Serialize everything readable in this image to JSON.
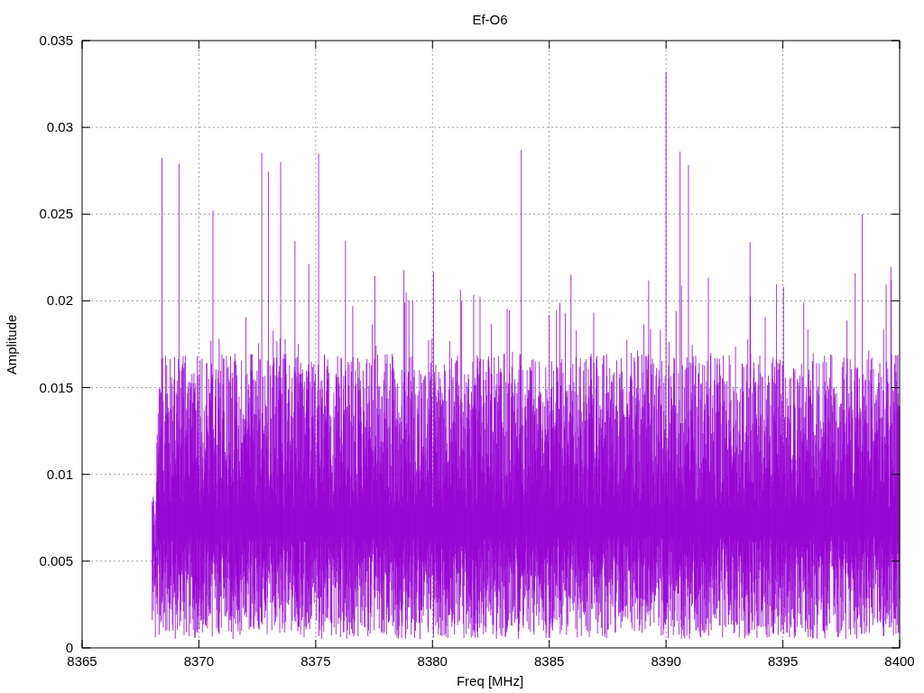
{
  "chart": {
    "title": "Ef-O6",
    "xlabel": "Freq [MHz]",
    "ylabel": "Amplitude",
    "xticks": [
      "8365",
      "8370",
      "8375",
      "8380",
      "8385",
      "8390",
      "8395",
      "8400"
    ],
    "yticks": [
      "0.035",
      "0.03",
      "0.025",
      "0.02",
      "0.015",
      "0.01",
      "0.005",
      "0"
    ]
  }
}
